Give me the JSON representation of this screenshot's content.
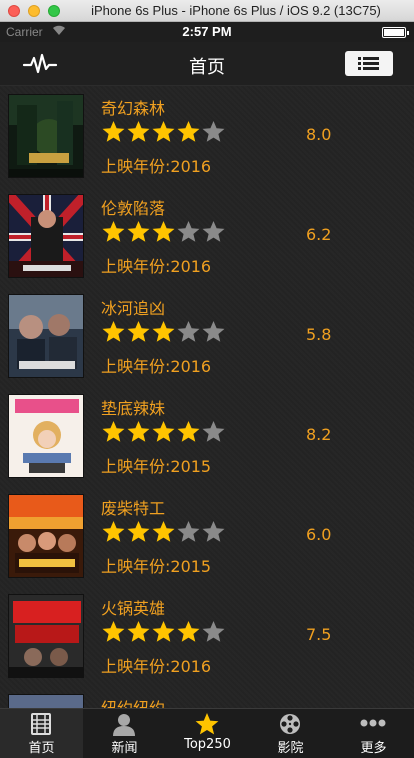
{
  "window": {
    "title": "iPhone 6s Plus - iPhone 6s Plus / iOS 9.2 (13C75)"
  },
  "statusbar": {
    "carrier": "Carrier",
    "time": "2:57 PM",
    "battery_level": 1.0
  },
  "navbar": {
    "title": "首页",
    "left_icon": "pulse-icon",
    "right_icon": "list-icon"
  },
  "colors": {
    "accent": "#f0a020",
    "star_on": "#ffc400",
    "star_off": "#8a8a8a"
  },
  "movies": [
    {
      "title": "奇幻森林",
      "rating_stars": 4,
      "score": "8.0",
      "year_label": "上映年份:2016"
    },
    {
      "title": "伦敦陷落",
      "rating_stars": 3,
      "score": "6.2",
      "year_label": "上映年份:2016"
    },
    {
      "title": "冰河追凶",
      "rating_stars": 3,
      "score": "5.8",
      "year_label": "上映年份:2016"
    },
    {
      "title": "垫底辣妹",
      "rating_stars": 4,
      "score": "8.2",
      "year_label": "上映年份:2015"
    },
    {
      "title": "废柴特工",
      "rating_stars": 3,
      "score": "6.0",
      "year_label": "上映年份:2015"
    },
    {
      "title": "火锅英雄",
      "rating_stars": 4,
      "score": "7.5",
      "year_label": "上映年份:2016"
    },
    {
      "title": "纽约纽约",
      "rating_stars": 0,
      "score": "",
      "year_label": ""
    }
  ],
  "tabs": [
    {
      "label": "首页",
      "icon": "film-icon",
      "active": true
    },
    {
      "label": "新闻",
      "icon": "user-icon",
      "active": false
    },
    {
      "label": "Top250",
      "icon": "star-icon",
      "active": false
    },
    {
      "label": "影院",
      "icon": "film-reel-icon",
      "active": false
    },
    {
      "label": "更多",
      "icon": "more-icon",
      "active": false
    }
  ]
}
